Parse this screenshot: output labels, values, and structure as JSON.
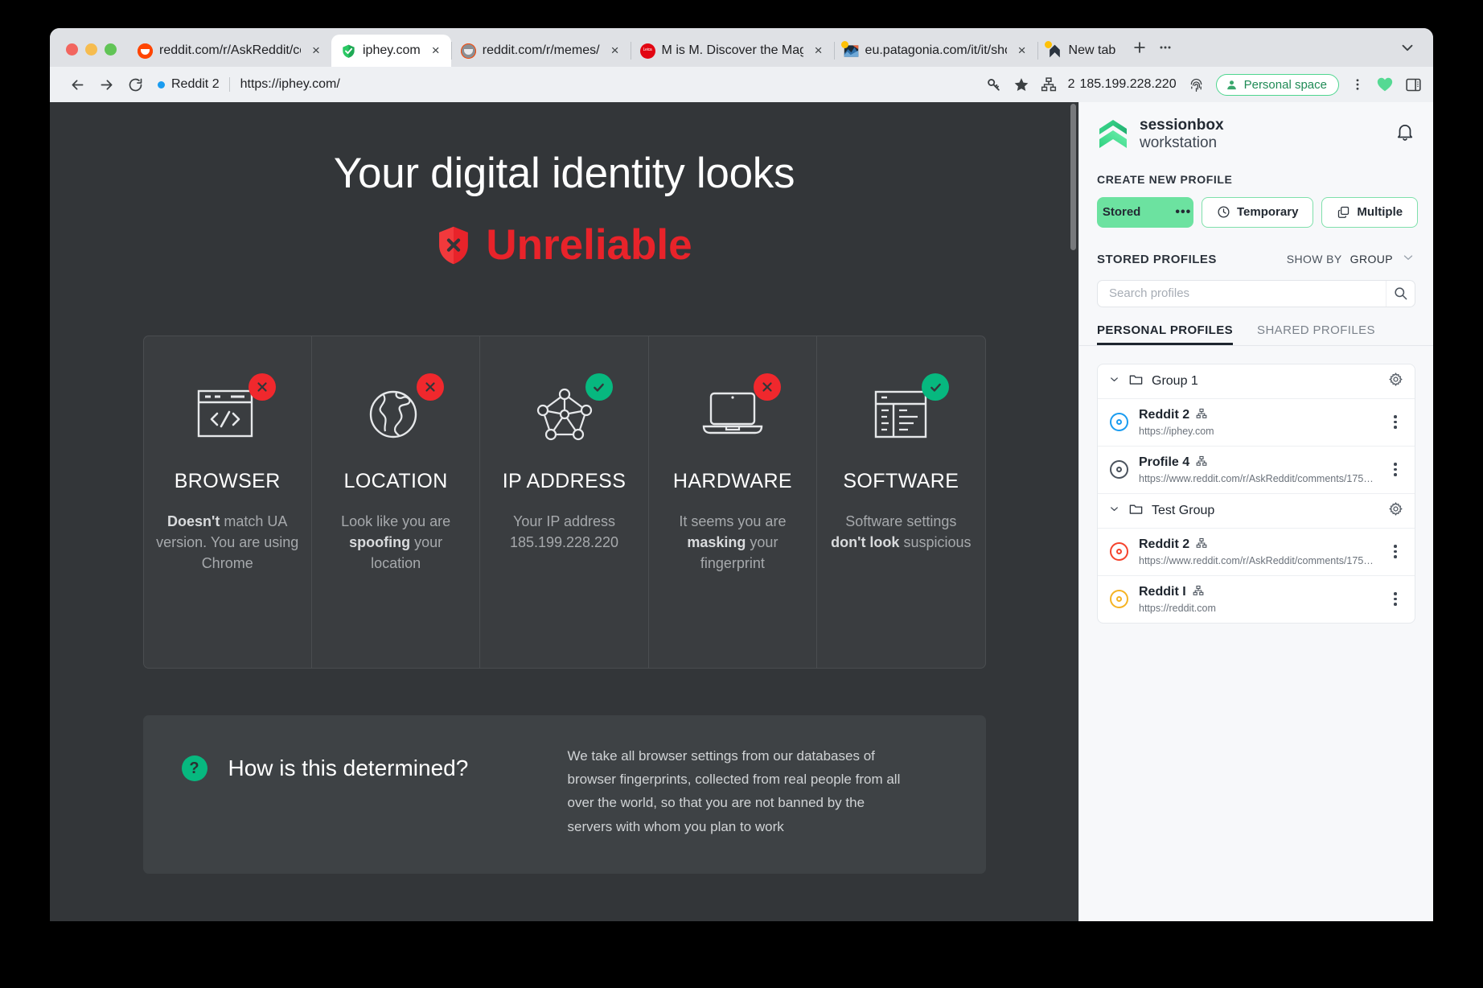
{
  "window": {
    "traffic_lights": [
      "close",
      "minimize",
      "zoom"
    ]
  },
  "tabs": [
    {
      "title": "reddit.com/r/AskReddit/com",
      "favicon": "reddit-icon",
      "active": false,
      "close": "×"
    },
    {
      "title": "iphey.com",
      "favicon": "shield-check-icon",
      "active": true,
      "close": "×"
    },
    {
      "title": "reddit.com/r/memes/",
      "favicon": "reddit-grey-icon",
      "active": false,
      "close": "×"
    },
    {
      "title": "M is M. Discover the Magic.",
      "favicon": "leica-icon",
      "active": false,
      "close": "×"
    },
    {
      "title": "eu.patagonia.com/it/it/shop/",
      "favicon": "patagonia-icon",
      "active": false,
      "close": "×"
    },
    {
      "title": "New tab",
      "favicon": "sessionbox-icon",
      "active": false,
      "close": ""
    }
  ],
  "tabstrip": {
    "new_tab_label": "+",
    "overflow_label": "•••",
    "tab_search_label": "⌄"
  },
  "toolbar": {
    "back_label": "←",
    "forward_label": "→",
    "reload_label": "↻",
    "profile_chip_label": "Reddit 2",
    "url": "https://iphey.com/",
    "ip_count": "2",
    "ip_address": "185.199.228.220",
    "personal_space_label": "Personal space",
    "icons": [
      "key-icon",
      "star-icon",
      "proxy-network-icon",
      "fingerprint-icon",
      "person-icon",
      "kebab-menu-icon",
      "heart-icon",
      "side-panel-icon"
    ]
  },
  "page": {
    "headline": "Your digital identity looks",
    "verdict": "Unreliable",
    "verdict_color": "#e8232a",
    "cards": [
      {
        "title": "BROWSER",
        "status": "bad",
        "icon": "browser-code-icon",
        "desc_parts": [
          {
            "text": "Doesn't",
            "bold": true
          },
          {
            "text": " match UA version. You are using Chrome",
            "bold": false
          }
        ]
      },
      {
        "title": "LOCATION",
        "status": "bad",
        "icon": "globe-icon",
        "desc_parts": [
          {
            "text": "Look like you are ",
            "bold": false
          },
          {
            "text": "spoofing",
            "bold": true
          },
          {
            "text": " your location",
            "bold": false
          }
        ]
      },
      {
        "title": "IP ADDRESS",
        "status": "good",
        "icon": "network-nodes-icon",
        "desc_parts": [
          {
            "text": "Your IP address 185.199.228.220",
            "bold": false
          }
        ]
      },
      {
        "title": "HARDWARE",
        "status": "bad",
        "icon": "laptop-icon",
        "desc_parts": [
          {
            "text": "It seems you are ",
            "bold": false
          },
          {
            "text": "masking",
            "bold": true
          },
          {
            "text": " your fingerprint",
            "bold": false
          }
        ]
      },
      {
        "title": "SOFTWARE",
        "status": "good",
        "icon": "software-window-icon",
        "desc_parts": [
          {
            "text": "Software settings ",
            "bold": false
          },
          {
            "text": "don't look",
            "bold": true
          },
          {
            "text": " suspicious",
            "bold": false
          }
        ]
      }
    ],
    "determined": {
      "badge": "?",
      "title": "How is this determined?",
      "body": "We take all browser settings from our databases of browser fingerprints, collected from real people from all over the world, so that you are not banned by the servers with whom you plan to work"
    }
  },
  "sidebar": {
    "logo": {
      "line1": "sessionbox",
      "line2": "workstation",
      "mark": "sessionbox-logo-icon"
    },
    "bell": "bell-icon",
    "create_new_profile_label": "CREATE NEW PROFILE",
    "create_buttons": {
      "stored": "Stored",
      "stored_more": "•••",
      "temporary": "Temporary",
      "multiple": "Multiple"
    },
    "stored_profiles_label": "STORED PROFILES",
    "show_by_label": "SHOW BY",
    "show_by_value": "GROUP",
    "search_placeholder": "Search profiles",
    "search_value": "",
    "tabs": [
      {
        "label": "PERSONAL PROFILES",
        "active": true
      },
      {
        "label": "SHARED PROFILES",
        "active": false
      }
    ],
    "groups": [
      {
        "name": "Group 1",
        "profiles": [
          {
            "name": "Reddit 2",
            "url": "https://iphey.com",
            "color": "blue"
          },
          {
            "name": "Profile 4",
            "url": "https://www.reddit.com/r/AskReddit/comments/175…",
            "color": "grey"
          }
        ]
      },
      {
        "name": "Test Group",
        "profiles": [
          {
            "name": "Reddit 2",
            "url": "https://www.reddit.com/r/AskReddit/comments/175…",
            "color": "red"
          },
          {
            "name": "Reddit I",
            "url": "https://reddit.com",
            "color": "amber"
          }
        ]
      }
    ]
  },
  "colors": {
    "accent_green": "#6ce2a0",
    "page_bg": "#333639",
    "bad_red": "#f0282d",
    "good_green": "#07b87f",
    "sidebar_bg": "#f7f8fa"
  }
}
